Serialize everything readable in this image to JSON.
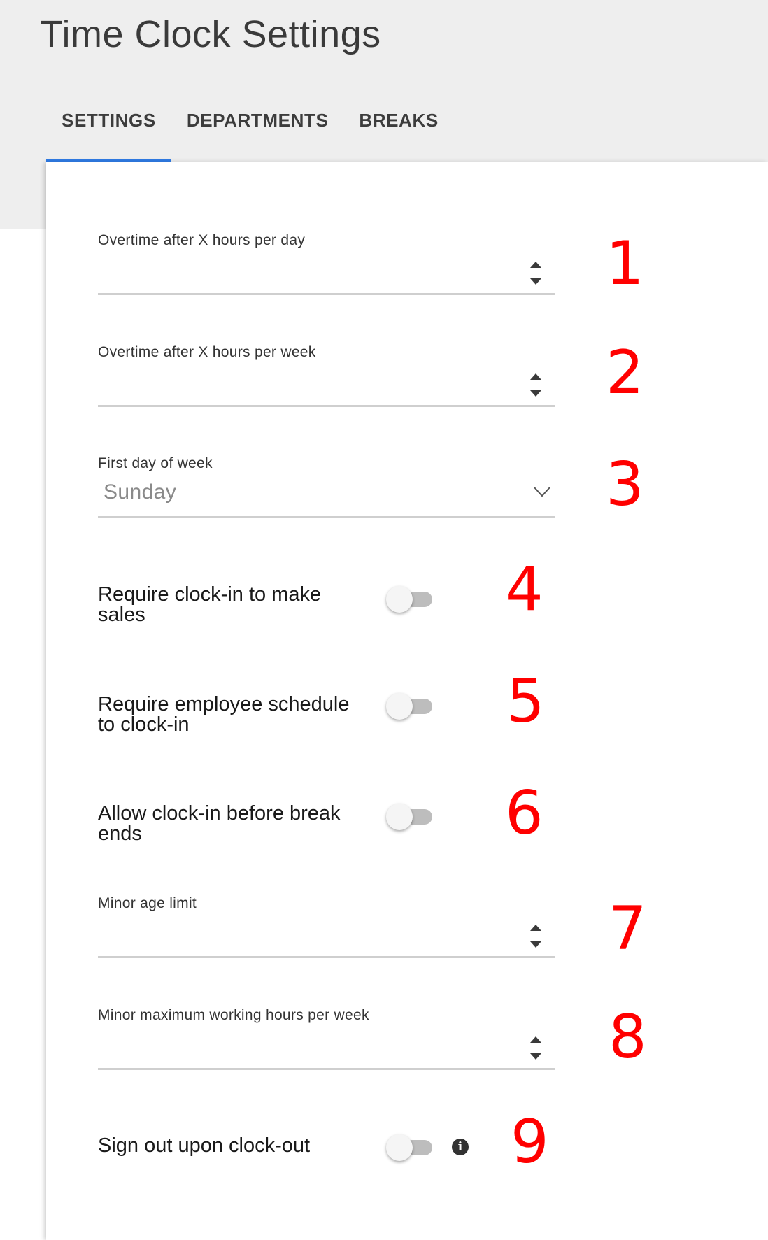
{
  "page": {
    "title": "Time Clock Settings"
  },
  "tabs": [
    {
      "label": "SETTINGS",
      "active": true
    },
    {
      "label": "DEPARTMENTS",
      "active": false
    },
    {
      "label": "BREAKS",
      "active": false
    }
  ],
  "fields": {
    "overtime_day": {
      "label": "Overtime after X hours per day",
      "value": ""
    },
    "overtime_week": {
      "label": "Overtime after X hours per week",
      "value": ""
    },
    "first_day": {
      "label": "First day of week",
      "value": "Sunday"
    },
    "minor_age": {
      "label": "Minor age limit",
      "value": ""
    },
    "minor_hours": {
      "label": "Minor maximum working hours per week",
      "value": ""
    }
  },
  "toggles": {
    "require_clock_in": {
      "label": "Require clock-in to make sales",
      "on": false
    },
    "require_schedule": {
      "label": "Require employee schedule to clock-in",
      "on": false
    },
    "allow_before_break": {
      "label": "Allow clock-in before break ends",
      "on": false
    },
    "sign_out": {
      "label": "Sign out upon clock-out",
      "on": false
    }
  },
  "markers": [
    "1",
    "2",
    "3",
    "4",
    "5",
    "6",
    "7",
    "8",
    "9"
  ],
  "colors": {
    "accent": "#2f7be5",
    "marker": "#ff0000",
    "toggle_track": "#bdbdbd"
  },
  "icons": {
    "info": "info-icon",
    "spinner": "spinner-arrows-icon",
    "select": "chevron-down-icon"
  }
}
